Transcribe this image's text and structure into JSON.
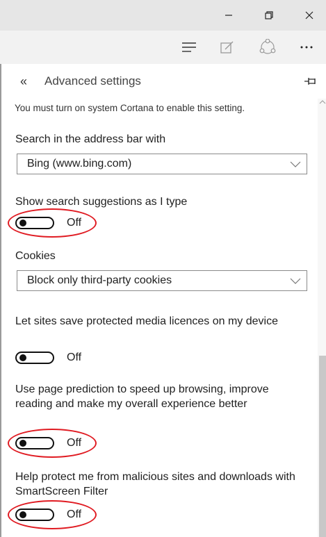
{
  "window": {
    "minimize_icon": "minimize-icon",
    "restore_icon": "restore-icon",
    "close_icon": "close-icon"
  },
  "toolbar": {
    "icons": [
      "hub-icon",
      "web-note-icon",
      "share-icon",
      "more-icon"
    ]
  },
  "panel": {
    "back_label": "«",
    "title": "Advanced settings",
    "pin_icon": "pin-icon"
  },
  "settings": {
    "cortana_note": "You must turn on system Cortana to enable this setting.",
    "search_label": "Search in the address bar with",
    "search_value": "Bing (www.bing.com)",
    "suggestions_label": "Show search suggestions as I type",
    "suggestions_state": "Off",
    "cookies_label": "Cookies",
    "cookies_value": "Block only third-party cookies",
    "media_label": "Let sites save protected media licences on my device",
    "media_state": "Off",
    "prediction_label": "Use page prediction to speed up browsing, improve reading and make my overall experience better",
    "prediction_state": "Off",
    "smartscreen_label": "Help protect me from malicious sites and downloads with SmartScreen Filter",
    "smartscreen_state": "Off"
  },
  "colors": {
    "highlight_ring": "#e01b22",
    "titlebar": "#e6e6e6",
    "toolbar": "#f2f2f2"
  }
}
